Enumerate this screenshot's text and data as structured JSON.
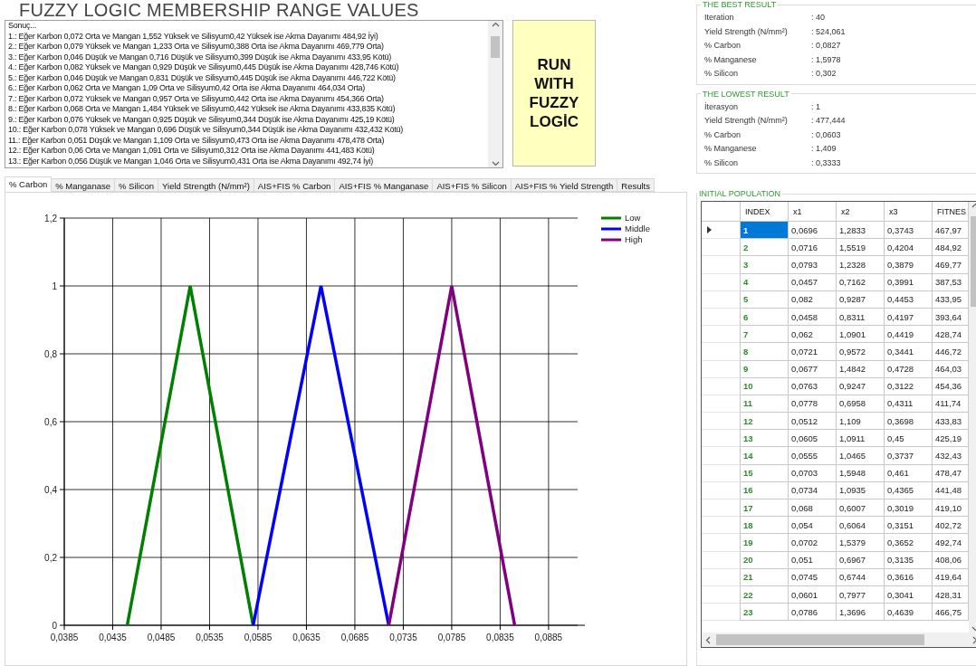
{
  "title": "FUZZY LOGIC MEMBERSHIP RANGE VALUES",
  "results_log": {
    "lines": [
      "Sonuç...",
      "1.: Eğer Karbon 0,072 Orta ve Mangan 1,552 Yüksek ve Silisyum0,42 Yüksek ise Akma Dayanımı 484,92 İyi)",
      "2.: Eğer Karbon 0,079 Yüksek ve Mangan 1,233 Orta ve Silisyum0,388 Orta ise Akma Dayanımı 469,779 Orta)",
      "3.: Eğer Karbon 0,046 Düşük ve Mangan 0,716 Düşük ve Silisyum0,399 Düşük ise Akma Dayanımı 433,95 Kötü)",
      "4.: Eğer Karbon 0,082 Yüksek ve Mangan 0,929 Düşük ve Silisyum0,445 Düşük ise Akma Dayanımı 428,746 Kötü)",
      "5.: Eğer Karbon 0,046 Düşük ve Mangan 0,831 Düşük ve Silisyum0,445 Düşük ise Akma Dayanımı 446,722 Kötü)",
      "6.: Eğer Karbon 0,062 Orta ve Mangan 1,09 Orta ve Silisyum0,42 Orta ise Akma Dayanımı 464,034 Orta)",
      "7.: Eğer Karbon 0,072 Yüksek ve Mangan 0,957 Orta ve Silisyum0,442 Orta ise Akma Dayanımı 454,366 Orta)",
      "8.: Eğer Karbon 0,068 Orta ve Mangan 1,484 Yüksek ve Silisyum0,442 Yüksek ise Akma Dayanımı 433,835 Kötü)",
      "9.: Eğer Karbon 0,076 Yüksek ve Mangan 0,925 Düşük ve Silisyum0,344 Düşük ise Akma Dayanımı 425,19 Kötü)",
      "10.: Eğer Karbon 0,078 Yüksek ve Mangan 0,696 Düşük ve Silisyum0,344 Düşük ise Akma Dayanımı 432,432 Kötü)",
      "11.: Eğer Karbon 0,051 Düşük ve Mangan 1,109 Orta ve Silisyum0,473 Orta ise Akma Dayanımı 478,478 Orta)",
      "12.: Eğer Karbon 0,06 Orta ve Mangan 1,091 Orta ve Silisyum0,312 Orta ise Akma Dayanımı 441,483 Kötü)",
      "13.: Eğer Karbon 0,056 Düşük ve Mangan 1,046 Orta ve Silisyum0,431 Orta ise Akma Dayanımı 492,74 İyi)"
    ]
  },
  "run_button": {
    "label": "RUN WITH FUZZY LOGİC"
  },
  "tabs": [
    {
      "label": "% Carbon",
      "selected": true
    },
    {
      "label": "% Manganase",
      "selected": false
    },
    {
      "label": "% Silicon",
      "selected": false
    },
    {
      "label": "Yield Strength (N/mm²)",
      "selected": false
    },
    {
      "label": "AIS+FIS % Carbon",
      "selected": false
    },
    {
      "label": "AIS+FIS % Manganase",
      "selected": false
    },
    {
      "label": "AIS+FIS % Silicon",
      "selected": false
    },
    {
      "label": "AIS+FIS % Yield Strength",
      "selected": false
    },
    {
      "label": "Results",
      "selected": false
    }
  ],
  "chart": {
    "chart_data": {
      "type": "line",
      "x": [
        0.045,
        0.0515,
        0.058,
        0.065,
        0.072,
        0.0785,
        0.085
      ],
      "series": [
        {
          "name": "Low",
          "color": "#008000",
          "values": [
            0,
            1,
            0,
            null,
            null,
            null,
            null
          ]
        },
        {
          "name": "Middle",
          "color": "#0000ff",
          "values": [
            null,
            null,
            0,
            1,
            0,
            null,
            null
          ]
        },
        {
          "name": "High",
          "color": "#800080",
          "values": [
            null,
            null,
            null,
            null,
            0,
            1,
            0
          ]
        }
      ],
      "xlim": [
        0.0385,
        0.0915
      ],
      "ylim": [
        0,
        1.2
      ],
      "grid": true,
      "legend": true,
      "xticks": [
        {
          "value": 0.0385,
          "label": "0,0385"
        },
        {
          "value": 0.0435,
          "label": "0,0435"
        },
        {
          "value": 0.0485,
          "label": "0,0485"
        },
        {
          "value": 0.0535,
          "label": "0,0535"
        },
        {
          "value": 0.0585,
          "label": "0,0585"
        },
        {
          "value": 0.0635,
          "label": "0,0635"
        },
        {
          "value": 0.0685,
          "label": "0,0685"
        },
        {
          "value": 0.0735,
          "label": "0,0735"
        },
        {
          "value": 0.0785,
          "label": "0,0785"
        },
        {
          "value": 0.0835,
          "label": "0,0835"
        },
        {
          "value": 0.0885,
          "label": "0,0885"
        }
      ],
      "yticks": [
        {
          "value": 0,
          "label": "0"
        },
        {
          "value": 0.2,
          "label": "0,2"
        },
        {
          "value": 0.4,
          "label": "0,4"
        },
        {
          "value": 0.6,
          "label": "0,6"
        },
        {
          "value": 0.8,
          "label": "0,8"
        },
        {
          "value": 1,
          "label": "1"
        },
        {
          "value": 1.2,
          "label": "1,2"
        }
      ]
    }
  },
  "best_result": {
    "title": "THE BEST RESULT",
    "rows": [
      {
        "label": "Iteration",
        "value": ": 40"
      },
      {
        "label": "Yield Strength (N/mm²)",
        "value": ": 524,061"
      },
      {
        "label": "% Carbon",
        "value": ": 0,0827"
      },
      {
        "label": "% Manganese",
        "value": ": 1,5978"
      },
      {
        "label": "% Silicon",
        "value": ": 0,302"
      }
    ]
  },
  "lowest_result": {
    "title": "THE LOWEST RESULT",
    "rows": [
      {
        "label": "İterasyon",
        "value": ": 1"
      },
      {
        "label": "Yield Strength (N/mm²)",
        "value": ": 477,444"
      },
      {
        "label": "% Carbon",
        "value": ": 0,0603"
      },
      {
        "label": "% Manganese",
        "value": ": 1,409"
      },
      {
        "label": "% Silicon",
        "value": ": 0,3333"
      }
    ]
  },
  "initial_population": {
    "title": "INITIAL POPULATION",
    "columns": [
      "INDEX",
      "x1",
      "x2",
      "x3",
      "FITNES"
    ],
    "rows": [
      {
        "selected": true,
        "cells": [
          "1",
          "0,0696",
          "1,2833",
          "0,3743",
          "467,97"
        ]
      },
      {
        "selected": false,
        "cells": [
          "2",
          "0,0716",
          "1,5519",
          "0,4204",
          "484,92"
        ]
      },
      {
        "selected": false,
        "cells": [
          "3",
          "0,0793",
          "1,2328",
          "0,3879",
          "469,77"
        ]
      },
      {
        "selected": false,
        "cells": [
          "4",
          "0,0457",
          "0,7162",
          "0,3991",
          "387,53"
        ]
      },
      {
        "selected": false,
        "cells": [
          "5",
          "0,082",
          "0,9287",
          "0,4453",
          "433,95"
        ]
      },
      {
        "selected": false,
        "cells": [
          "6",
          "0,0458",
          "0,8311",
          "0,4197",
          "393,64"
        ]
      },
      {
        "selected": false,
        "cells": [
          "7",
          "0,062",
          "1,0901",
          "0,4419",
          "428,74"
        ]
      },
      {
        "selected": false,
        "cells": [
          "8",
          "0,0721",
          "0,9572",
          "0,3441",
          "446,72"
        ]
      },
      {
        "selected": false,
        "cells": [
          "9",
          "0,0677",
          "1,4842",
          "0,4728",
          "464,03"
        ]
      },
      {
        "selected": false,
        "cells": [
          "10",
          "0,0763",
          "0,9247",
          "0,3122",
          "454,36"
        ]
      },
      {
        "selected": false,
        "cells": [
          "11",
          "0,0778",
          "0,6958",
          "0,4311",
          "411,74"
        ]
      },
      {
        "selected": false,
        "cells": [
          "12",
          "0,0512",
          "1,109",
          "0,3698",
          "433,83"
        ]
      },
      {
        "selected": false,
        "cells": [
          "13",
          "0,0605",
          "1,0911",
          "0,45",
          "425,19"
        ]
      },
      {
        "selected": false,
        "cells": [
          "14",
          "0,0555",
          "1,0465",
          "0,3737",
          "432,43"
        ]
      },
      {
        "selected": false,
        "cells": [
          "15",
          "0,0703",
          "1,5948",
          "0,461",
          "478,47"
        ]
      },
      {
        "selected": false,
        "cells": [
          "16",
          "0,0734",
          "1,0935",
          "0,4365",
          "441,48"
        ]
      },
      {
        "selected": false,
        "cells": [
          "17",
          "0,068",
          "0,6007",
          "0,3019",
          "419,10"
        ]
      },
      {
        "selected": false,
        "cells": [
          "18",
          "0,054",
          "0,6064",
          "0,3151",
          "402,72"
        ]
      },
      {
        "selected": false,
        "cells": [
          "19",
          "0,0702",
          "1,5379",
          "0,3652",
          "492,74"
        ]
      },
      {
        "selected": false,
        "cells": [
          "20",
          "0,051",
          "0,6967",
          "0,3135",
          "408,06"
        ]
      },
      {
        "selected": false,
        "cells": [
          "21",
          "0,0745",
          "0,6744",
          "0,3616",
          "419,64"
        ]
      },
      {
        "selected": false,
        "cells": [
          "22",
          "0,0601",
          "0,7977",
          "0,3041",
          "428,31"
        ]
      },
      {
        "selected": false,
        "cells": [
          "23",
          "0,0786",
          "1,3696",
          "0,4639",
          "466,75"
        ]
      }
    ]
  }
}
